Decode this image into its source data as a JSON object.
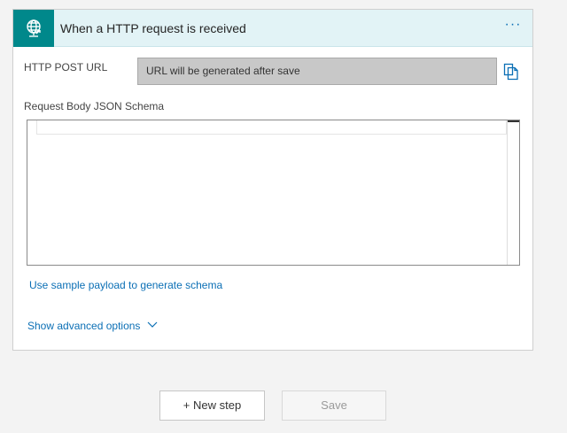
{
  "trigger": {
    "title": "When a HTTP request is received",
    "more_label": "···",
    "icon": "globe-icon",
    "accent_color": "#00888b"
  },
  "http_post_url": {
    "label": "HTTP POST URL",
    "value": "URL will be generated after save",
    "copy_icon": "copy-icon"
  },
  "schema": {
    "label": "Request Body JSON Schema",
    "value": ""
  },
  "links": {
    "sample_payload": "Use sample payload to generate schema",
    "advanced_options": "Show advanced options",
    "link_color": "#0b6fb5"
  },
  "actions": {
    "new_step": "+ New step",
    "save": "Save"
  }
}
